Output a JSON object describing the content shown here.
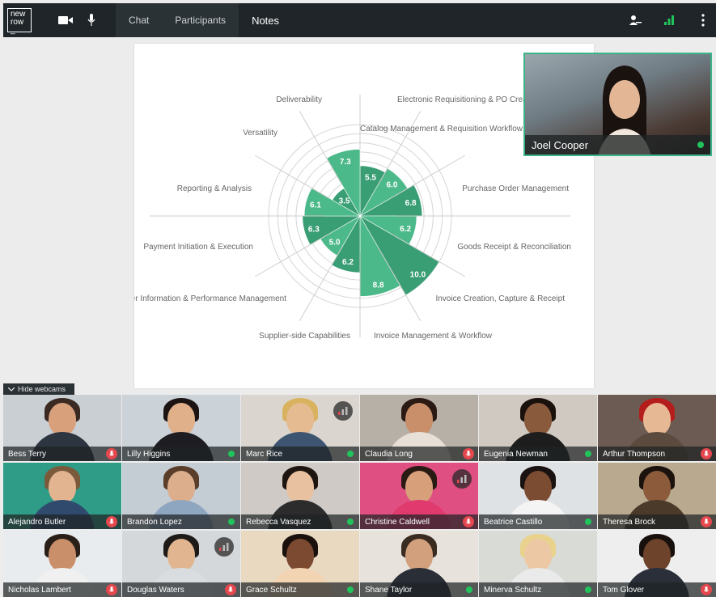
{
  "logo": {
    "line1": "new",
    "line2": "row",
    "line3": "_"
  },
  "tabs": [
    {
      "label": "Chat"
    },
    {
      "label": "Participants"
    },
    {
      "label": "Notes"
    }
  ],
  "icons": {
    "camera": "video-camera-icon",
    "mic": "microphone-icon",
    "presenter": "presenter-icon",
    "signal": "signal-bars-icon",
    "more": "more-vertical-icon"
  },
  "colors": {
    "accent": "#3cb48a",
    "status_green": "#21c45b",
    "mic_red": "#e4484e",
    "topbar": "#1f2528"
  },
  "floating_video": {
    "name": "Joel Cooper"
  },
  "hide_webcams": {
    "label": "Hide webcams"
  },
  "chart_data": {
    "type": "polar_bar",
    "max": 10,
    "categories": [
      {
        "label": "Electronic Requisitioning & PO Creation",
        "value": 5.5
      },
      {
        "label": "Catalog Management & Requisition Workflow",
        "value": 6.0
      },
      {
        "label": "Purchase Order Management",
        "value": 6.8
      },
      {
        "label": "Goods Receipt & Reconciliation",
        "value": 6.2
      },
      {
        "label": "Invoice Creation, Capture & Receipt",
        "value": 10.0
      },
      {
        "label": "Invoice Management & Workflow",
        "value": 8.8
      },
      {
        "label": "Supplier-side Capabilities",
        "value": 6.2
      },
      {
        "label": "Supplier Information & Performance Management",
        "value": 5.0
      },
      {
        "label": "Payment Initiation & Execution",
        "value": 6.3
      },
      {
        "label": "Reporting & Analysis",
        "value": 6.1
      },
      {
        "label": "Versatility",
        "value": 3.5
      },
      {
        "label": "Deliverability",
        "value": 7.3
      }
    ]
  },
  "webcams": [
    {
      "name": "Bess Terry",
      "status": "mic"
    },
    {
      "name": "Lilly Higgins",
      "status": "green"
    },
    {
      "name": "Marc Rice",
      "status": "green",
      "signal": true
    },
    {
      "name": "Claudia Long",
      "status": "mic"
    },
    {
      "name": "Eugenia Newman",
      "status": "green"
    },
    {
      "name": "Arthur Thompson",
      "status": "mic"
    },
    {
      "name": "Alejandro Butler",
      "status": "mic"
    },
    {
      "name": "Brandon Lopez",
      "status": "green"
    },
    {
      "name": "Rebecca Vasquez",
      "status": "green"
    },
    {
      "name": "Christine Caldwell",
      "status": "mic",
      "signal": true
    },
    {
      "name": "Beatrice Castillo",
      "status": "green"
    },
    {
      "name": "Theresa Brock",
      "status": "mic"
    },
    {
      "name": "Nicholas Lambert",
      "status": "mic"
    },
    {
      "name": "Douglas Waters",
      "status": "mic",
      "signal": true
    },
    {
      "name": "Grace Schultz",
      "status": "green"
    },
    {
      "name": "Shane Taylor",
      "status": "green"
    },
    {
      "name": "Minerva Schultz",
      "status": "green"
    },
    {
      "name": "Tom Glover",
      "status": "mic"
    }
  ]
}
